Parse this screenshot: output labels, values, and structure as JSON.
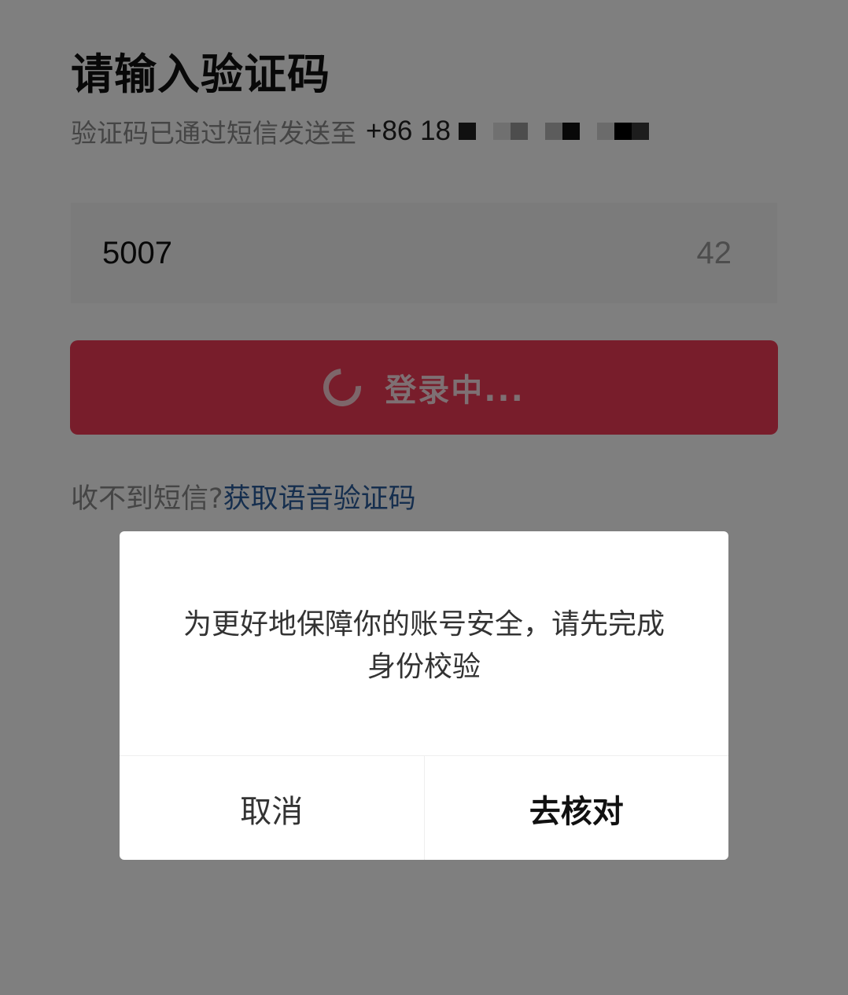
{
  "page": {
    "title": "请输入验证码",
    "subtitle_prefix": "验证码已通过短信发送至",
    "phone_visible": "+86 18"
  },
  "code_input": {
    "value": "5007",
    "countdown": "42"
  },
  "login_button": {
    "label": "登录中..."
  },
  "help": {
    "prompt": "收不到短信?",
    "voice_link": "获取语音验证码"
  },
  "dialog": {
    "message": "为更好地保障你的账号安全，请先完成身份校验",
    "cancel_label": "取消",
    "confirm_label": "去核对"
  },
  "colors": {
    "accent": "#f03a56",
    "link": "#2a5d9c",
    "overlay": "rgba(0,0,0,0.5)"
  },
  "icons": {
    "loading": "spinner-icon"
  }
}
